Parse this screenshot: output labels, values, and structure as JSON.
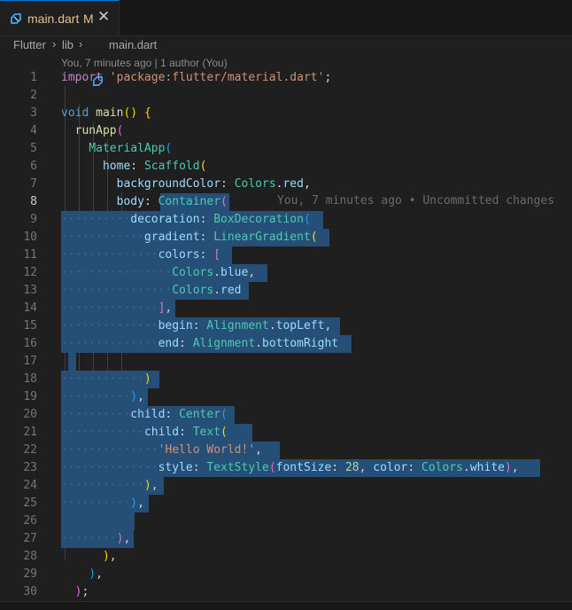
{
  "tab": {
    "label": "main.dart",
    "modified": "M",
    "close": "✕"
  },
  "breadcrumb": {
    "items": [
      "Flutter",
      "lib",
      "main.dart"
    ],
    "separator": "›"
  },
  "blame": {
    "header": "You, 7 minutes ago | 1 author (You)",
    "inline": "You, 7 minutes ago • Uncommitted changes"
  },
  "editor": {
    "active_line": 8,
    "lines": [
      {
        "n": "1",
        "tokens": [
          [
            "kw",
            "import"
          ],
          [
            "plain",
            " "
          ],
          [
            "str",
            "'package:flutter/material.dart'"
          ],
          [
            "plain",
            ";"
          ]
        ]
      },
      {
        "n": "2",
        "tokens": []
      },
      {
        "n": "3",
        "tokens": [
          [
            "kwb",
            "void"
          ],
          [
            "plain",
            " "
          ],
          [
            "fn",
            "main"
          ],
          [
            "b1",
            "()"
          ],
          [
            "plain",
            " "
          ],
          [
            "b1",
            "{"
          ]
        ]
      },
      {
        "n": "4",
        "tokens": [
          [
            "plain",
            "  "
          ],
          [
            "fn",
            "runApp"
          ],
          [
            "b2",
            "("
          ]
        ]
      },
      {
        "n": "5",
        "tokens": [
          [
            "plain",
            "    "
          ],
          [
            "cls",
            "MaterialApp"
          ],
          [
            "b3",
            "("
          ]
        ]
      },
      {
        "n": "6",
        "tokens": [
          [
            "plain",
            "      "
          ],
          [
            "prop",
            "home"
          ],
          [
            "plain",
            ": "
          ],
          [
            "cls",
            "Scaffold"
          ],
          [
            "b1",
            "("
          ]
        ]
      },
      {
        "n": "7",
        "tokens": [
          [
            "plain",
            "        "
          ],
          [
            "prop",
            "backgroundColor"
          ],
          [
            "plain",
            ": "
          ],
          [
            "cls",
            "Colors"
          ],
          [
            "plain",
            "."
          ],
          [
            "prop",
            "red"
          ],
          [
            "plain",
            ","
          ]
        ]
      },
      {
        "n": "8",
        "tokens": [
          [
            "plain",
            "        "
          ],
          [
            "prop",
            "body"
          ],
          [
            "plain",
            ": "
          ],
          [
            "cls",
            "Container"
          ],
          [
            "b2",
            "("
          ]
        ]
      },
      {
        "n": "9",
        "tokens": [
          [
            "ws",
            "··········"
          ],
          [
            "prop",
            "decoration"
          ],
          [
            "plain",
            ": "
          ],
          [
            "cls",
            "BoxDecoration"
          ],
          [
            "b3",
            "("
          ]
        ]
      },
      {
        "n": "10",
        "tokens": [
          [
            "ws",
            "············"
          ],
          [
            "prop",
            "gradient"
          ],
          [
            "plain",
            ": "
          ],
          [
            "cls",
            "LinearGradient"
          ],
          [
            "b1",
            "("
          ]
        ]
      },
      {
        "n": "11",
        "tokens": [
          [
            "ws",
            "··············"
          ],
          [
            "prop",
            "colors"
          ],
          [
            "plain",
            ": "
          ],
          [
            "b2",
            "["
          ]
        ]
      },
      {
        "n": "12",
        "tokens": [
          [
            "ws",
            "················"
          ],
          [
            "cls",
            "Colors"
          ],
          [
            "plain",
            "."
          ],
          [
            "prop",
            "blue"
          ],
          [
            "plain",
            ","
          ]
        ]
      },
      {
        "n": "13",
        "tokens": [
          [
            "ws",
            "················"
          ],
          [
            "cls",
            "Colors"
          ],
          [
            "plain",
            "."
          ],
          [
            "prop",
            "red"
          ]
        ]
      },
      {
        "n": "14",
        "tokens": [
          [
            "ws",
            "··············"
          ],
          [
            "b2",
            "]"
          ],
          [
            "plain",
            ","
          ]
        ]
      },
      {
        "n": "15",
        "tokens": [
          [
            "ws",
            "··············"
          ],
          [
            "prop",
            "begin"
          ],
          [
            "plain",
            ": "
          ],
          [
            "cls",
            "Alignment"
          ],
          [
            "plain",
            "."
          ],
          [
            "prop",
            "topLeft"
          ],
          [
            "plain",
            ","
          ]
        ]
      },
      {
        "n": "16",
        "tokens": [
          [
            "ws",
            "··············"
          ],
          [
            "prop",
            "end"
          ],
          [
            "plain",
            ": "
          ],
          [
            "cls",
            "Alignment"
          ],
          [
            "plain",
            "."
          ],
          [
            "prop",
            "bottomRight"
          ]
        ]
      },
      {
        "n": "17",
        "tokens": []
      },
      {
        "n": "18",
        "tokens": [
          [
            "ws",
            "············"
          ],
          [
            "b1",
            ")"
          ]
        ]
      },
      {
        "n": "19",
        "tokens": [
          [
            "ws",
            "··········"
          ],
          [
            "b3",
            ")"
          ],
          [
            "plain",
            ","
          ]
        ]
      },
      {
        "n": "20",
        "tokens": [
          [
            "ws",
            "··········"
          ],
          [
            "prop",
            "child"
          ],
          [
            "plain",
            ": "
          ],
          [
            "cls",
            "Center"
          ],
          [
            "b3",
            "("
          ]
        ]
      },
      {
        "n": "21",
        "tokens": [
          [
            "ws",
            "············"
          ],
          [
            "prop",
            "child"
          ],
          [
            "plain",
            ": "
          ],
          [
            "cls",
            "Text"
          ],
          [
            "b1",
            "("
          ]
        ]
      },
      {
        "n": "22",
        "tokens": [
          [
            "ws",
            "··············"
          ],
          [
            "str",
            "'Hello World!'"
          ],
          [
            "plain",
            ","
          ]
        ]
      },
      {
        "n": "23",
        "tokens": [
          [
            "ws",
            "··············"
          ],
          [
            "prop",
            "style"
          ],
          [
            "plain",
            ": "
          ],
          [
            "cls",
            "TextStyle"
          ],
          [
            "b2",
            "("
          ],
          [
            "prop",
            "fontSize"
          ],
          [
            "plain",
            ": "
          ],
          [
            "num",
            "28"
          ],
          [
            "plain",
            ", "
          ],
          [
            "prop",
            "color"
          ],
          [
            "plain",
            ": "
          ],
          [
            "cls",
            "Colors"
          ],
          [
            "plain",
            "."
          ],
          [
            "prop",
            "white"
          ],
          [
            "b2",
            ")"
          ],
          [
            "plain",
            ","
          ]
        ]
      },
      {
        "n": "24",
        "tokens": [
          [
            "ws",
            "············"
          ],
          [
            "b1",
            ")"
          ],
          [
            "plain",
            ","
          ]
        ]
      },
      {
        "n": "25",
        "tokens": [
          [
            "ws",
            "··········"
          ],
          [
            "b3",
            ")"
          ],
          [
            "plain",
            ","
          ]
        ]
      },
      {
        "n": "26",
        "tokens": []
      },
      {
        "n": "27",
        "tokens": [
          [
            "ws",
            "········"
          ],
          [
            "b2",
            ")"
          ],
          [
            "plain",
            ","
          ]
        ]
      },
      {
        "n": "28",
        "tokens": [
          [
            "plain",
            "      "
          ],
          [
            "b1",
            ")"
          ],
          [
            "plain",
            ","
          ]
        ]
      },
      {
        "n": "29",
        "tokens": [
          [
            "plain",
            "    "
          ],
          [
            "b3",
            ")"
          ],
          [
            "plain",
            ","
          ]
        ]
      },
      {
        "n": "30",
        "tokens": [
          [
            "plain",
            "  "
          ],
          [
            "b2",
            ")"
          ],
          [
            "plain",
            ";"
          ]
        ]
      }
    ]
  }
}
